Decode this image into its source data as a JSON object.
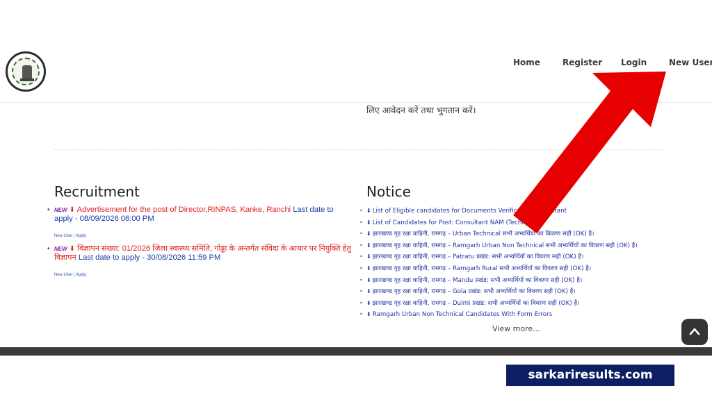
{
  "nav": {
    "home": "Home",
    "register": "Register",
    "login": "Login",
    "new_user": "New User"
  },
  "intro_tail": "लिए आवेदन करें तथा भुगतान करें।",
  "recruitment": {
    "title": "Recruitment",
    "items": [
      {
        "badge": "NEW",
        "text": "Advertisement for the post of Director,RINPAS, Kanke, Ranchi",
        "deadline": "Last date to apply - 08/09/2026 06:00 PM",
        "link_new_user": "New User",
        "link_sep": " | ",
        "link_apply": "Apply"
      },
      {
        "badge": "NEW",
        "text": "विज्ञापन संख्या: 01/2026 जिला स्वास्थ्य समिति, गोड्डा के अन्तर्गत संविदा के आधार पर नियुक्ति हेतु विज्ञापन",
        "deadline": "Last date to apply - 30/08/2026 11:59 PM",
        "link_new_user": "New User",
        "link_sep": " | ",
        "link_apply": "Apply"
      }
    ]
  },
  "notice": {
    "title": "Notice",
    "items": [
      "List of Eligible candidates for Documents Verification Consultant",
      "List of Candidates for Post: Consultant NAM (Technical)",
      "झारखण्ड गृह रक्षा वाहिनी, रामगढ़ – Urban Technical सभी अभ्यर्थियों का विवरण सही (OK) है।",
      "झारखण्ड गृह रक्षा वाहिनी, रामगढ़ – Ramgarh Urban Non Technical सभी अभ्यर्थियों का विवरण सही (OK) है।",
      "झारखण्ड गृह रक्षा वाहिनी, रामगढ़ – Patratu प्रखंड: सभी अभ्यर्थियों का विवरण सही (OK) है।",
      "झारखण्ड गृह रक्षा वाहिनी, रामगढ़ – Ramgarh Rural सभी अभ्यर्थियों का विवरण सही (OK) है।",
      "झारखण्ड गृह रक्षा वाहिनी, रामगढ़ – Mandu प्रखंड: सभी अभ्यर्थियों का विवरण सही (OK) है।",
      "झारखण्ड गृह रक्षा वाहिनी, रामगढ़ – Gola प्रखंड: सभी अभ्यर्थियों का विवरण सही (OK) है।",
      "झारखण्ड गृह रक्षा वाहिनी, रामगढ़ – Dulmi प्रखंड: सभी अभ्यर्थियों का विवरण सही (OK) है।",
      "Ramgarh Urban Non Technical Candidates With Form Errors"
    ],
    "view_more": "View more..."
  },
  "icons": {
    "download": "download-icon",
    "back_to_top": "chevron-up-icon",
    "logo": "state-emblem-logo"
  },
  "watermark": "sarkariresults.com",
  "colors": {
    "new_badge": "#7b1fa2",
    "recruit_text": "#e0201c",
    "link_blue": "#1a3aa8",
    "arrow": "#e60000",
    "watermark_bg": "#0d1f63",
    "footer": "#3a3a3a"
  }
}
